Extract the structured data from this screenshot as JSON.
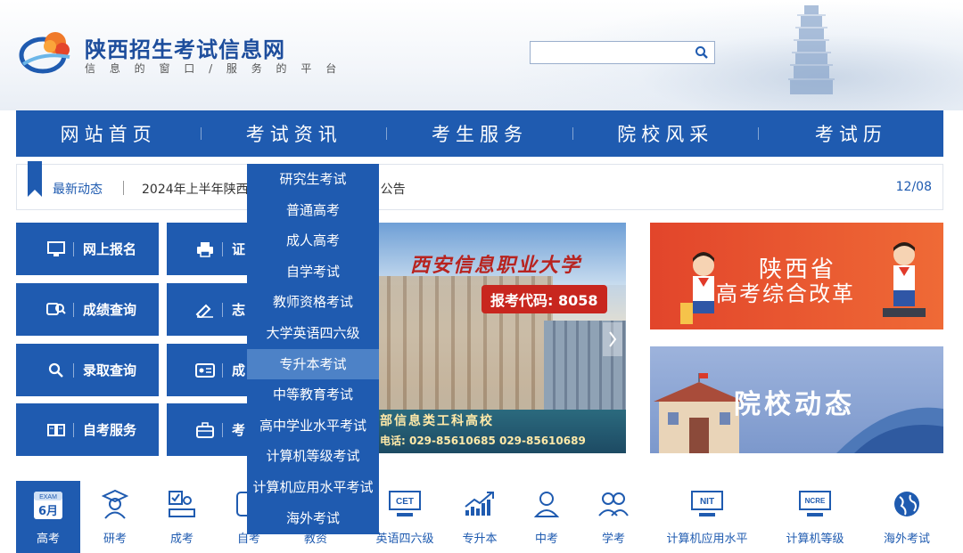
{
  "header": {
    "title": "陕西招生考试信息网",
    "slogan": "信 息 的 窗 口 / 服 务 的 平 台",
    "search_placeholder": ""
  },
  "nav": [
    "网站首页",
    "考试资讯",
    "考生服务",
    "院校风采",
    "考试历"
  ],
  "ticker": {
    "label": "最新动态",
    "text": "2024年上半年陕西",
    "text_tail": "公告",
    "date": "12/08"
  },
  "services": {
    "online_register": "网上报名",
    "score_query": "成绩查询",
    "admission_query": "录取查询",
    "self_study": "自考服务",
    "col2_a": "证",
    "col2_b": "志",
    "col2_c": "成",
    "col2_d": "考"
  },
  "banner": {
    "university": "西安信息职业大学",
    "code": "报考代码: 8058",
    "line1": "部信息类工科高校",
    "line2": "电话: 029-85610685  029-85610689"
  },
  "promo": {
    "reform_line1": "陕西省",
    "reform_line2": "高考综合改革",
    "college_news": "院校动态"
  },
  "dropdown": [
    "研究生考试",
    "普通高考",
    "成人高考",
    "自学考试",
    "教师资格考试",
    "大学英语四六级",
    "专升本考试",
    "中等教育考试",
    "高中学业水平考试",
    "计算机等级考试",
    "计算机应用水平考试",
    "海外考试"
  ],
  "dropdown_active": "专升本考试",
  "categories": {
    "gaokao": "高考",
    "yankao": "研考",
    "chengkao": "成考",
    "zikao": "自考",
    "jiaozi": "教资",
    "cet": "英语四六级",
    "zhuanshengben": "专升本",
    "zhongkao": "中考",
    "xuekao": "学考",
    "comp_app": "计算机应用水平",
    "comp_level": "计算机等级",
    "overseas": "海外考试",
    "exam_badge_top": "EXAM",
    "exam_badge_month": "6月",
    "cet_badge": "CET",
    "nit_badge": "NIT",
    "ncre_badge": "NCRE"
  },
  "colors": {
    "primary": "#1f5bb0",
    "dropdown_highlight": "#4d82c7",
    "reform_banner": "#e2452b"
  }
}
